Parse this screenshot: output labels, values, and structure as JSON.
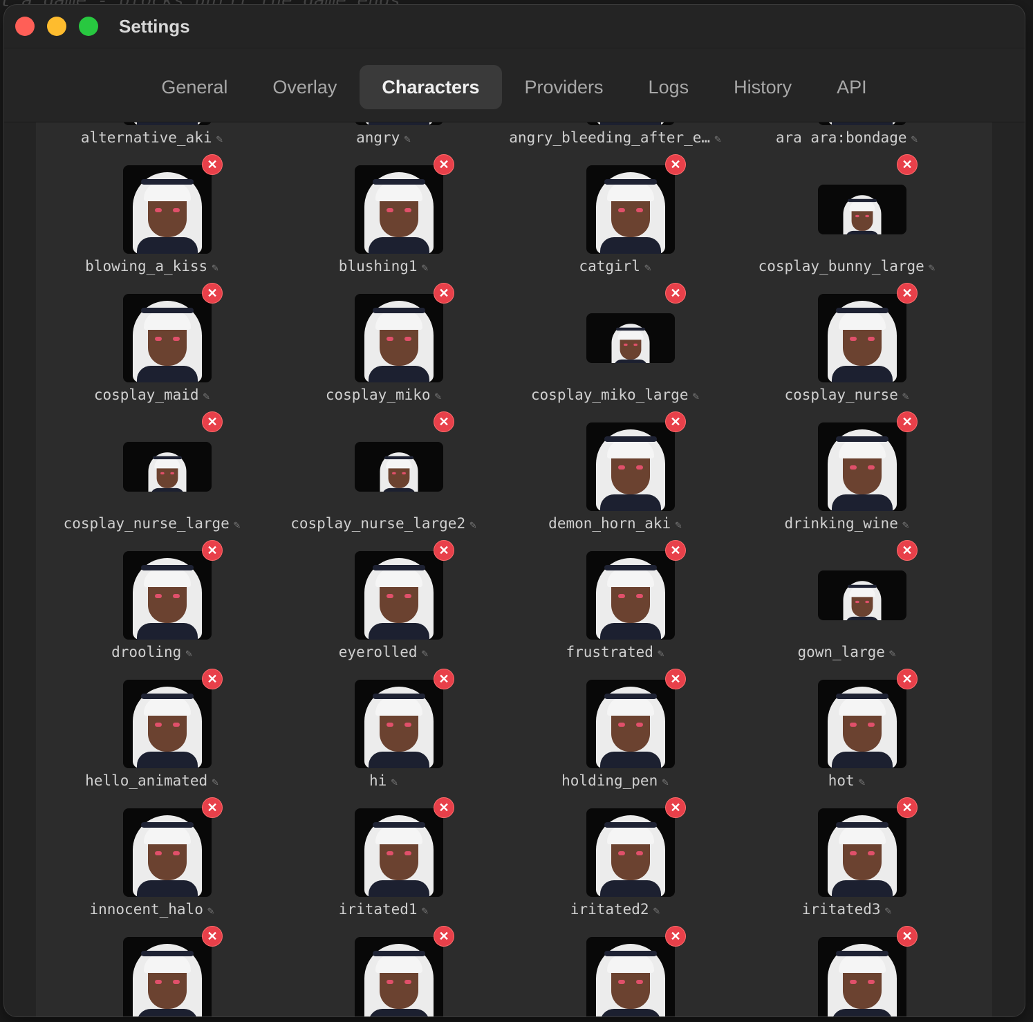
{
  "background_code": "t a game - blocks until the game ends",
  "window": {
    "title": "Settings"
  },
  "tabs": [
    {
      "label": "General",
      "active": false
    },
    {
      "label": "Overlay",
      "active": false
    },
    {
      "label": "Characters",
      "active": true
    },
    {
      "label": "Providers",
      "active": false
    },
    {
      "label": "Logs",
      "active": false
    },
    {
      "label": "History",
      "active": false
    },
    {
      "label": "API",
      "active": false
    }
  ],
  "characters": [
    {
      "name": "alternative_aki",
      "removable": false,
      "wide": false
    },
    {
      "name": "angry",
      "removable": false,
      "wide": false
    },
    {
      "name": "angry_bleeding_after_e…",
      "removable": false,
      "wide": false
    },
    {
      "name": "ara ara:bondage",
      "removable": false,
      "wide": false
    },
    {
      "name": "blowing_a_kiss",
      "removable": true,
      "wide": false
    },
    {
      "name": "blushing1",
      "removable": true,
      "wide": false
    },
    {
      "name": "catgirl",
      "removable": true,
      "wide": false
    },
    {
      "name": "cosplay_bunny_large",
      "removable": true,
      "wide": true
    },
    {
      "name": "cosplay_maid",
      "removable": true,
      "wide": false
    },
    {
      "name": "cosplay_miko",
      "removable": true,
      "wide": false
    },
    {
      "name": "cosplay_miko_large",
      "removable": true,
      "wide": true
    },
    {
      "name": "cosplay_nurse",
      "removable": true,
      "wide": false
    },
    {
      "name": "cosplay_nurse_large",
      "removable": true,
      "wide": true
    },
    {
      "name": "cosplay_nurse_large2",
      "removable": true,
      "wide": true
    },
    {
      "name": "demon_horn_aki",
      "removable": true,
      "wide": false
    },
    {
      "name": "drinking_wine",
      "removable": true,
      "wide": false
    },
    {
      "name": "drooling",
      "removable": true,
      "wide": false
    },
    {
      "name": "eyerolled",
      "removable": true,
      "wide": false
    },
    {
      "name": "frustrated",
      "removable": true,
      "wide": false
    },
    {
      "name": "gown_large",
      "removable": true,
      "wide": true
    },
    {
      "name": "hello_animated",
      "removable": true,
      "wide": false
    },
    {
      "name": "hi",
      "removable": true,
      "wide": false
    },
    {
      "name": "holding_pen",
      "removable": true,
      "wide": false
    },
    {
      "name": "hot",
      "removable": true,
      "wide": false
    },
    {
      "name": "innocent_halo",
      "removable": true,
      "wide": false
    },
    {
      "name": "iritated1",
      "removable": true,
      "wide": false
    },
    {
      "name": "iritated2",
      "removable": true,
      "wide": false
    },
    {
      "name": "iritated3",
      "removable": true,
      "wide": false
    },
    {
      "name": "",
      "removable": true,
      "wide": false
    },
    {
      "name": "",
      "removable": true,
      "wide": false
    },
    {
      "name": "",
      "removable": true,
      "wide": false
    },
    {
      "name": "",
      "removable": true,
      "wide": false
    }
  ],
  "icons": {
    "remove": "close-x-icon",
    "edit": "pencil-icon"
  },
  "colors": {
    "remove_badge": "#e8404a",
    "tab_active_bg": "#3a3a3a"
  }
}
